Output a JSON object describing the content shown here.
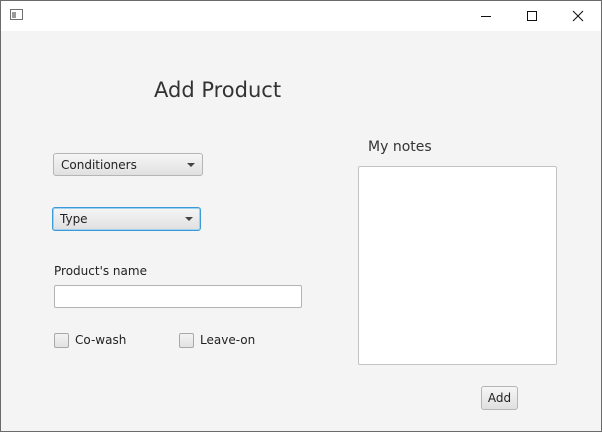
{
  "window": {
    "controls": {
      "minimize_icon": "minimize-icon",
      "maximize_icon": "maximize-icon",
      "close_icon": "close-icon"
    }
  },
  "form": {
    "title": "Add Product",
    "category_select": {
      "selected": "Conditioners"
    },
    "type_select": {
      "selected": "Type"
    },
    "name_label": "Product's name",
    "name_value": "",
    "checkboxes": [
      {
        "label": "Co-wash",
        "checked": false
      },
      {
        "label": "Leave-on",
        "checked": false
      }
    ],
    "notes_label": "My notes",
    "notes_value": "",
    "add_button": "Add"
  },
  "colors": {
    "background": "#f4f4f4",
    "focus_border": "#3a9bd6"
  }
}
